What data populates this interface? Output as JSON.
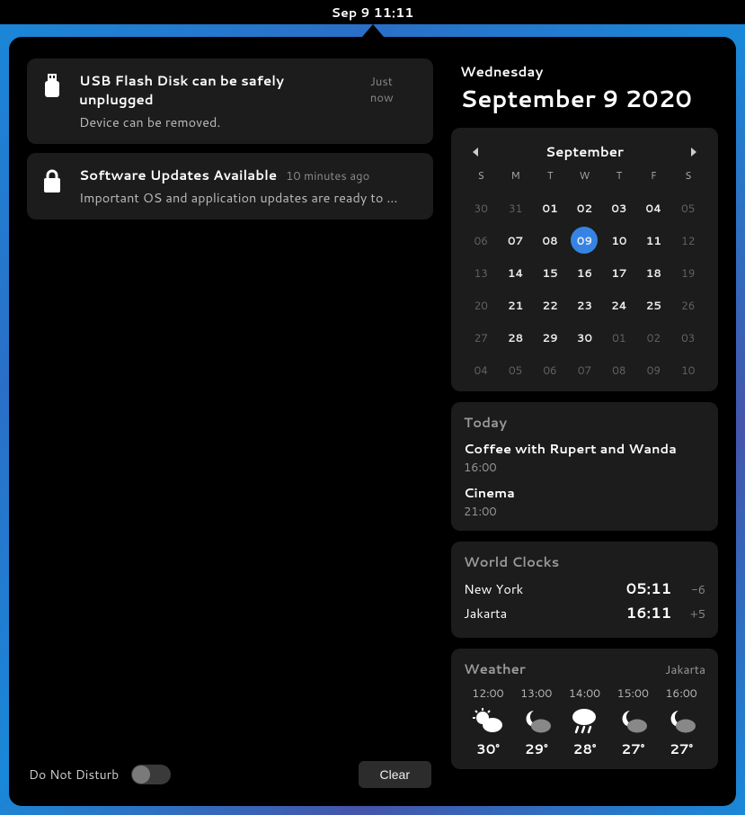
{
  "topbar": {
    "clock": "Sep 9  11:11"
  },
  "notifications": [
    {
      "icon": "usb",
      "title": "USB Flash Disk can be safely unplugged",
      "time": "Just now",
      "message": "Device can be removed."
    },
    {
      "icon": "lock",
      "title": "Software Updates Available",
      "time": "10 minutes ago",
      "message": "Important OS and application updates are ready to …"
    }
  ],
  "dnd_label": "Do Not Disturb",
  "clear_label": "Clear",
  "date": {
    "weekday": "Wednesday",
    "full": "September 9 2020"
  },
  "calendar": {
    "month": "September",
    "dow": [
      "S",
      "M",
      "T",
      "W",
      "T",
      "F",
      "S"
    ],
    "weeks": [
      [
        {
          "n": "30",
          "dim": true
        },
        {
          "n": "31",
          "dim": true
        },
        {
          "n": "01"
        },
        {
          "n": "02"
        },
        {
          "n": "03"
        },
        {
          "n": "04"
        },
        {
          "n": "05",
          "dim": true
        }
      ],
      [
        {
          "n": "06",
          "dim": true
        },
        {
          "n": "07"
        },
        {
          "n": "08"
        },
        {
          "n": "09",
          "today": true
        },
        {
          "n": "10"
        },
        {
          "n": "11"
        },
        {
          "n": "12",
          "dim": true
        }
      ],
      [
        {
          "n": "13",
          "dim": true
        },
        {
          "n": "14"
        },
        {
          "n": "15"
        },
        {
          "n": "16"
        },
        {
          "n": "17"
        },
        {
          "n": "18"
        },
        {
          "n": "19",
          "dim": true
        }
      ],
      [
        {
          "n": "20",
          "dim": true
        },
        {
          "n": "21"
        },
        {
          "n": "22"
        },
        {
          "n": "23"
        },
        {
          "n": "24"
        },
        {
          "n": "25"
        },
        {
          "n": "26",
          "dim": true
        }
      ],
      [
        {
          "n": "27",
          "dim": true
        },
        {
          "n": "28"
        },
        {
          "n": "29"
        },
        {
          "n": "30"
        },
        {
          "n": "01",
          "dim": true
        },
        {
          "n": "02",
          "dim": true
        },
        {
          "n": "03",
          "dim": true
        }
      ],
      [
        {
          "n": "04",
          "dim": true
        },
        {
          "n": "05",
          "dim": true
        },
        {
          "n": "06",
          "dim": true
        },
        {
          "n": "07",
          "dim": true
        },
        {
          "n": "08",
          "dim": true
        },
        {
          "n": "09",
          "dim": true
        },
        {
          "n": "10",
          "dim": true
        }
      ]
    ]
  },
  "agenda": {
    "title": "Today",
    "items": [
      {
        "title": "Coffee with Rupert and Wanda",
        "time": "16:00"
      },
      {
        "title": "Cinema",
        "time": "21:00"
      }
    ]
  },
  "world_clocks": {
    "title": "World Clocks",
    "rows": [
      {
        "city": "New York",
        "time": "05:11",
        "offset": "-6"
      },
      {
        "city": "Jakarta",
        "time": "16:11",
        "offset": "+5"
      }
    ]
  },
  "weather": {
    "title": "Weather",
    "location": "Jakarta",
    "hours": [
      {
        "time": "12:00",
        "icon": "sun-cloud",
        "temp": "30°"
      },
      {
        "time": "13:00",
        "icon": "moon-cloud",
        "temp": "29°"
      },
      {
        "time": "14:00",
        "icon": "rain",
        "temp": "28°"
      },
      {
        "time": "15:00",
        "icon": "moon-cloud",
        "temp": "27°"
      },
      {
        "time": "16:00",
        "icon": "moon-cloud",
        "temp": "27°"
      }
    ]
  }
}
